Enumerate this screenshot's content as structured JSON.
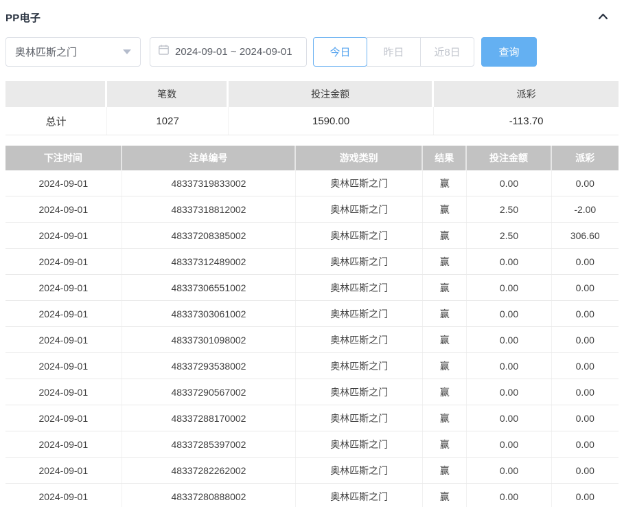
{
  "header": {
    "title": "PP电子",
    "collapse_icon": "chevron-up"
  },
  "filters": {
    "game_select": {
      "value": "奥林匹斯之门",
      "icon": "caret-down"
    },
    "date_range": {
      "value": "2024-09-01 ~ 2024-09-01",
      "icon": "calendar"
    },
    "quick_buttons": [
      {
        "key": "today",
        "label": "今日",
        "active": true
      },
      {
        "key": "yesterday",
        "label": "昨日",
        "active": false
      },
      {
        "key": "last-8-days",
        "label": "近8日",
        "active": false
      }
    ],
    "query_label": "查询"
  },
  "summary": {
    "columns": [
      "",
      "笔数",
      "投注金额",
      "派彩"
    ],
    "total_label": "总计",
    "count": "1027",
    "bet_amount": "1590.00",
    "payout": "-113.70",
    "payout_negative": true
  },
  "table": {
    "columns": [
      "下注时间",
      "注单编号",
      "游戏类别",
      "结果",
      "投注金额",
      "派彩"
    ],
    "column_keys": [
      "bet-time",
      "ticket-number",
      "game-category",
      "result",
      "bet-amount",
      "payout"
    ],
    "rows": [
      {
        "time": "2024-09-01",
        "ticket": "48337319833002",
        "game": "奥林匹斯之门",
        "result": "赢",
        "bet": "0.00",
        "payout": "0.00"
      },
      {
        "time": "2024-09-01",
        "ticket": "48337318812002",
        "game": "奥林匹斯之门",
        "result": "赢",
        "bet": "2.50",
        "payout": "-2.00"
      },
      {
        "time": "2024-09-01",
        "ticket": "48337208385002",
        "game": "奥林匹斯之门",
        "result": "赢",
        "bet": "2.50",
        "payout": "306.60"
      },
      {
        "time": "2024-09-01",
        "ticket": "48337312489002",
        "game": "奥林匹斯之门",
        "result": "赢",
        "bet": "0.00",
        "payout": "0.00"
      },
      {
        "time": "2024-09-01",
        "ticket": "48337306551002",
        "game": "奥林匹斯之门",
        "result": "赢",
        "bet": "0.00",
        "payout": "0.00"
      },
      {
        "time": "2024-09-01",
        "ticket": "48337303061002",
        "game": "奥林匹斯之门",
        "result": "赢",
        "bet": "0.00",
        "payout": "0.00"
      },
      {
        "time": "2024-09-01",
        "ticket": "48337301098002",
        "game": "奥林匹斯之门",
        "result": "赢",
        "bet": "0.00",
        "payout": "0.00"
      },
      {
        "time": "2024-09-01",
        "ticket": "48337293538002",
        "game": "奥林匹斯之门",
        "result": "赢",
        "bet": "0.00",
        "payout": "0.00"
      },
      {
        "time": "2024-09-01",
        "ticket": "48337290567002",
        "game": "奥林匹斯之门",
        "result": "赢",
        "bet": "0.00",
        "payout": "0.00"
      },
      {
        "time": "2024-09-01",
        "ticket": "48337288170002",
        "game": "奥林匹斯之门",
        "result": "赢",
        "bet": "0.00",
        "payout": "0.00"
      },
      {
        "time": "2024-09-01",
        "ticket": "48337285397002",
        "game": "奥林匹斯之门",
        "result": "赢",
        "bet": "0.00",
        "payout": "0.00"
      },
      {
        "time": "2024-09-01",
        "ticket": "48337282262002",
        "game": "奥林匹斯之门",
        "result": "赢",
        "bet": "0.00",
        "payout": "0.00"
      },
      {
        "time": "2024-09-01",
        "ticket": "48337280888002",
        "game": "奥林匹斯之门",
        "result": "赢",
        "bet": "0.00",
        "payout": "0.00"
      }
    ]
  },
  "colors": {
    "accent_blue": "#64b0f2",
    "active_border_blue": "#6cb2f2",
    "negative_red": "#f0615e",
    "table_header_gray": "#c2c2c2",
    "summary_header_gray": "#eaeaea"
  }
}
